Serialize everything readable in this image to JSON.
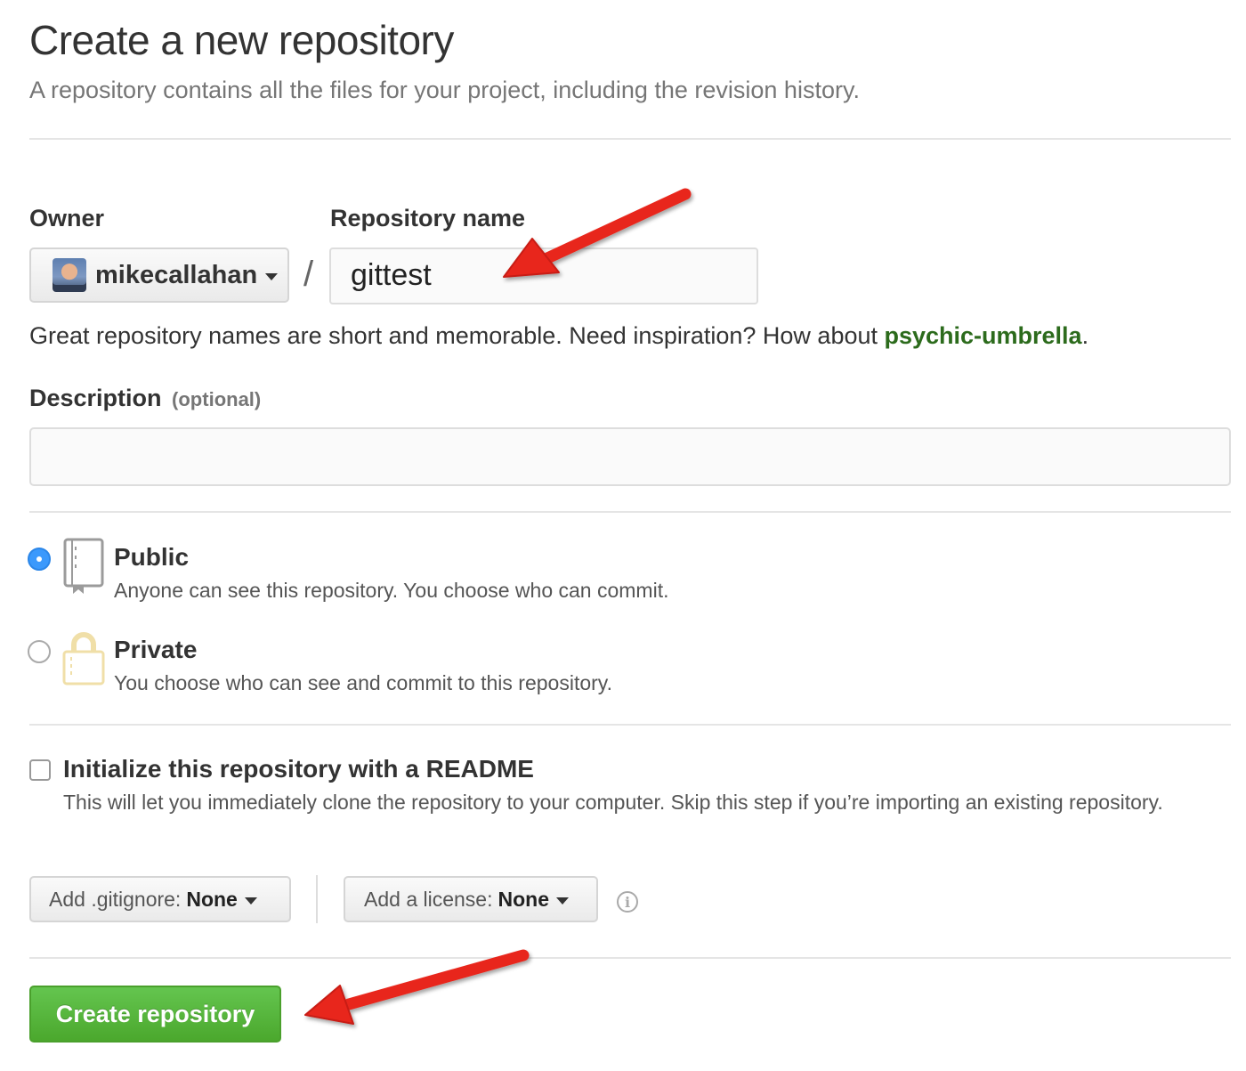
{
  "header": {
    "title": "Create a new repository",
    "subtitle": "A repository contains all the files for your project, including the revision history."
  },
  "owner": {
    "label": "Owner",
    "name": "mikecallahan"
  },
  "slash": "/",
  "repo_name": {
    "label": "Repository name",
    "value": "gittest"
  },
  "hint": {
    "text": "Great repository names are short and memorable. Need inspiration? How about ",
    "suggestion": "psychic-umbrella",
    "end": "."
  },
  "description": {
    "label": "Description",
    "optional": "(optional)",
    "value": ""
  },
  "visibility": {
    "public": {
      "title": "Public",
      "desc": "Anyone can see this repository. You choose who can commit.",
      "selected": true
    },
    "private": {
      "title": "Private",
      "desc": "You choose who can see and commit to this repository.",
      "selected": false
    }
  },
  "readme": {
    "title": "Initialize this repository with a README",
    "desc": "This will let you immediately clone the repository to your computer. Skip this step if you’re importing an existing repository.",
    "checked": false
  },
  "gitignore": {
    "label": "Add .gitignore:",
    "value": "None"
  },
  "license": {
    "label": "Add a license:",
    "value": "None"
  },
  "info_icon": "i",
  "create_button": "Create repository",
  "colors": {
    "accent_green": "#4ba82d",
    "suggestion_green": "#2c6b1c",
    "radio_blue": "#3b99fc",
    "arrow_red": "#e8271b"
  },
  "icons": [
    "repo-book-icon",
    "lock-icon",
    "info-icon",
    "caret-down-icon",
    "annotation-arrow"
  ]
}
